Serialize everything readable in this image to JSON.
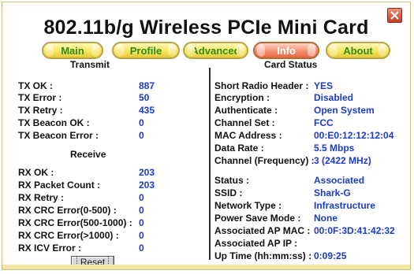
{
  "window": {
    "title": "802.11b/g Wireless PCIe Mini Card"
  },
  "tabs": [
    {
      "label": "Main"
    },
    {
      "label": "Profile"
    },
    {
      "label": "Advanced"
    },
    {
      "label": "Info",
      "active": true
    },
    {
      "label": "About"
    }
  ],
  "transmit": {
    "title": "Transmit",
    "rows": [
      {
        "label": "TX OK :",
        "value": "887"
      },
      {
        "label": "TX Error :",
        "value": "50"
      },
      {
        "label": "TX Retry :",
        "value": "435"
      },
      {
        "label": "TX Beacon OK :",
        "value": "0"
      },
      {
        "label": "TX Beacon Error :",
        "value": "0"
      }
    ]
  },
  "receive": {
    "title": "Receive",
    "rows": [
      {
        "label": "RX OK :",
        "value": "203"
      },
      {
        "label": "RX Packet Count :",
        "value": "203"
      },
      {
        "label": "RX Retry :",
        "value": "0"
      },
      {
        "label": "RX CRC Error(0-500) :",
        "value": "0"
      },
      {
        "label": "RX CRC Error(500-1000) :",
        "value": "0"
      },
      {
        "label": "RX CRC Error(>1000) :",
        "value": "0"
      },
      {
        "label": "RX ICV Error :",
        "value": "0"
      }
    ],
    "reset_label": "Reset"
  },
  "card_status": {
    "title": "Card Status",
    "rows": [
      {
        "label": "Short Radio Header :",
        "value": "YES"
      },
      {
        "label": "Encryption :",
        "value": "Disabled"
      },
      {
        "label": "Authenticate :",
        "value": "Open System"
      },
      {
        "label": "Channel Set :",
        "value": "FCC"
      },
      {
        "label": "MAC Address :",
        "value": "00:E0:12:12:12:04"
      },
      {
        "label": "Data Rate :",
        "value": "5.5 Mbps"
      },
      {
        "label": "Channel (Frequency) :",
        "value": "3 (2422 MHz)"
      },
      {
        "label": "Status :",
        "value": "Associated"
      },
      {
        "label": "SSID :",
        "value": "Shark-G"
      },
      {
        "label": "Network Type :",
        "value": "Infrastructure"
      },
      {
        "label": "Power Save Mode :",
        "value": "None"
      },
      {
        "label": "Associated AP MAC :",
        "value": "00:0F:3D:41:42:32"
      },
      {
        "label": "Associated AP IP :",
        "value": ""
      },
      {
        "label": "Up Time (hh:mm:ss) :",
        "value": "0:09:25"
      }
    ]
  },
  "icons": {
    "close": "close-icon"
  },
  "colors": {
    "value_text": "#1a3bd0",
    "tab_text": "#2f8b1d",
    "active_tab": "#f58f6f",
    "tab_fill": "#f6e55f",
    "close_bg": "#c73d20"
  }
}
